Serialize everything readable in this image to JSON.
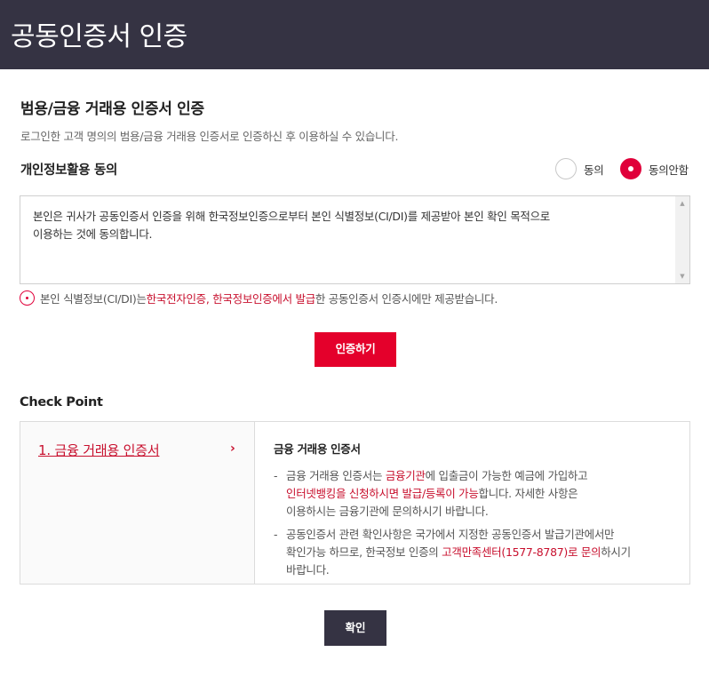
{
  "header": {
    "title": "공동인증서 인증"
  },
  "section": {
    "title": "범용/금융 거래용 인증서 인증",
    "description": "로그인한 고객 명의의 범용/금융 거래용 인증서로 인증하신 후 이용하실 수 있습니다."
  },
  "consent": {
    "title": "개인정보활용 동의",
    "options": [
      {
        "label": "동의",
        "checked": false
      },
      {
        "label": "동의안함",
        "checked": true
      }
    ],
    "terms_line1": "본인은 귀사가 공동인증서 인증을 위해 한국정보인증으로부터 본인 식별정보(CI/DI)를 제공받아 본인 확인 목적으로",
    "terms_line2": "이용하는 것에 동의합니다."
  },
  "notice": {
    "part1": "본인 식별정보(CI/DI)는 ",
    "highlight": "한국전자인증, 한국정보인증에서 발급",
    "part2": "한 공동인증서 인증시에만 제공받습니다."
  },
  "buttons": {
    "authenticate": "인증하기",
    "confirm": "확인"
  },
  "checkpoint": {
    "title": "Check Point",
    "link_label": "1. 금융 거래용 인증서",
    "arrow": "›",
    "content_title": "금융 거래용 인증서",
    "item1": {
      "a": "금융 거래용 인증서는 ",
      "b": "금융기관",
      "c": "에 입출금이 가능한 예금에 가입하고",
      "d": "인터넷뱅킹을 신청하시면 발급/등록이 가능",
      "e": "합니다. 자세한 사항은",
      "f": "이용하시는 금융기관에 문의하시기 바랍니다."
    },
    "item2": {
      "a": "공동인증서 관련 확인사항은 국가에서 지정한 공동인증서 발급기관에서만",
      "b": "확인가능 하므로, 한국정보 인증의 ",
      "c": "고객만족센터(1577-8787)로 문의",
      "d": "하시기",
      "e": "바랍니다."
    }
  },
  "colors": {
    "header_bg": "#353343",
    "accent": "#e4002b",
    "accent_text": "#c8102e"
  }
}
